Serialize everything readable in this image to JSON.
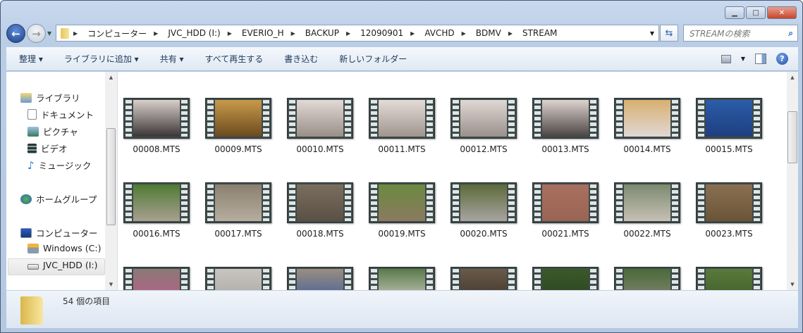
{
  "window": {
    "controls": {
      "minimize": "▁",
      "maximize": "□",
      "close": "✕"
    }
  },
  "address": {
    "crumbs": [
      "コンピューター",
      "JVC_HDD (I:)",
      "EVERIO_H",
      "BACKUP",
      "12090901",
      "AVCHD",
      "BDMV",
      "STREAM"
    ]
  },
  "search": {
    "placeholder": "STREAMの検索"
  },
  "toolbar": {
    "items": [
      "整理 ▾",
      "ライブラリに追加 ▾",
      "共有 ▾",
      "すべて再生する",
      "書き込む",
      "新しいフォルダー"
    ],
    "help": "?"
  },
  "nav": {
    "libraries": "ライブラリ",
    "documents": "ドキュメント",
    "pictures": "ピクチャ",
    "videos": "ビデオ",
    "music": "ミュージック",
    "homegroup": "ホームグループ",
    "computer": "コンピューター",
    "drive_c": "Windows (C:)",
    "drive_i": "JVC_HDD (I:)"
  },
  "files": [
    {
      "name": "00008.MTS",
      "colors": [
        "#d9cfcb",
        "#3a3636"
      ]
    },
    {
      "name": "00009.MTS",
      "colors": [
        "#c89a4a",
        "#6b4a1f"
      ]
    },
    {
      "name": "00010.MTS",
      "colors": [
        "#e2dad6",
        "#9a8e88"
      ]
    },
    {
      "name": "00011.MTS",
      "colors": [
        "#e4dcd8",
        "#a0948e"
      ]
    },
    {
      "name": "00012.MTS",
      "colors": [
        "#e0d8d4",
        "#9a908c"
      ]
    },
    {
      "name": "00013.MTS",
      "colors": [
        "#ddd3cf",
        "#4a4444"
      ]
    },
    {
      "name": "00014.MTS",
      "colors": [
        "#d8b070",
        "#e0d8d4"
      ]
    },
    {
      "name": "00015.MTS",
      "colors": [
        "#2a5da8",
        "#1f3f80"
      ]
    },
    {
      "name": "00016.MTS",
      "colors": [
        "#4f7a34",
        "#a8a090"
      ]
    },
    {
      "name": "00017.MTS",
      "colors": [
        "#8a8070",
        "#b6ad9e"
      ]
    },
    {
      "name": "00018.MTS",
      "colors": [
        "#7a6e5e",
        "#5a5044"
      ]
    },
    {
      "name": "00019.MTS",
      "colors": [
        "#6c8a40",
        "#8a7a60"
      ]
    },
    {
      "name": "00020.MTS",
      "colors": [
        "#5c6a3a",
        "#a8a4a0"
      ]
    },
    {
      "name": "00021.MTS",
      "colors": [
        "#a8705e",
        "#9a6454"
      ]
    },
    {
      "name": "00022.MTS",
      "colors": [
        "#7a8a70",
        "#c8c0b4"
      ]
    },
    {
      "name": "00023.MTS",
      "colors": [
        "#8a7050",
        "#6a5438"
      ]
    },
    {
      "name": "",
      "colors": [
        "#8a7a76",
        "#c05a8a"
      ]
    },
    {
      "name": "",
      "colors": [
        "#c8c4c0",
        "#a8a4a0"
      ]
    },
    {
      "name": "",
      "colors": [
        "#9a8e80",
        "#3a5aa0"
      ]
    },
    {
      "name": "",
      "colors": [
        "#5a7a4a",
        "#d8d4d0"
      ]
    },
    {
      "name": "",
      "colors": [
        "#6a5a4a",
        "#3a3028"
      ]
    },
    {
      "name": "",
      "colors": [
        "#3a5a2a",
        "#2a4020"
      ]
    },
    {
      "name": "",
      "colors": [
        "#4a6a3a",
        "#8a8a7a"
      ]
    },
    {
      "name": "",
      "colors": [
        "#5a7a3a",
        "#3a5a2a"
      ]
    }
  ],
  "status": {
    "count": "54 個の項目"
  }
}
